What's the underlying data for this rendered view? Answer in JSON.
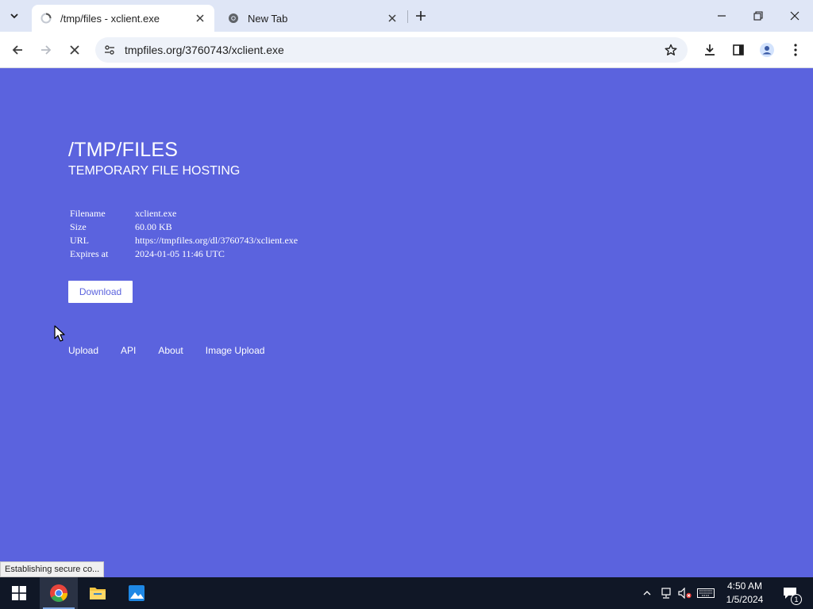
{
  "browser": {
    "tabs": [
      {
        "title": "/tmp/files - xclient.exe",
        "active": true
      },
      {
        "title": "New Tab",
        "active": false
      }
    ],
    "address": "tmpfiles.org/3760743/xclient.exe",
    "status_text": "Establishing secure co..."
  },
  "page": {
    "title": "/TMP/FILES",
    "subtitle": "TEMPORARY FILE HOSTING",
    "info": [
      {
        "label": "Filename",
        "value": "xclient.exe"
      },
      {
        "label": "Size",
        "value": "60.00 KB"
      },
      {
        "label": "URL",
        "value": "https://tmpfiles.org/dl/3760743/xclient.exe"
      },
      {
        "label": "Expires at",
        "value": "2024-01-05 11:46 UTC"
      }
    ],
    "download_label": "Download",
    "footer_links": [
      "Upload",
      "API",
      "About",
      "Image Upload"
    ],
    "colors": {
      "background": "#5b63de",
      "text": "#ffffff"
    }
  },
  "taskbar": {
    "time": "4:50 AM",
    "date": "1/5/2024",
    "notification_count": "1"
  }
}
